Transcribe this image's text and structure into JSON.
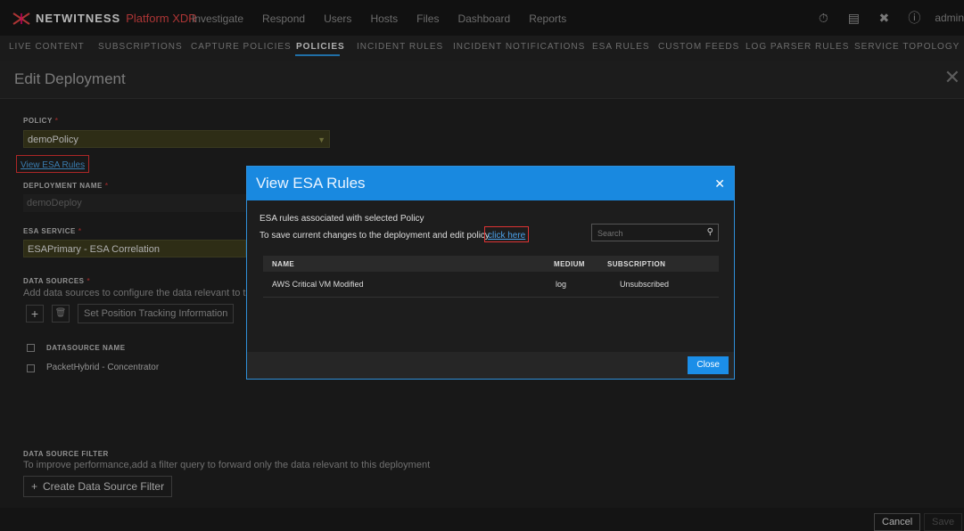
{
  "app": {
    "brand_name": "NETWITNESS",
    "brand_product": "Platform XDR",
    "nav": [
      "Investigate",
      "Respond",
      "Users",
      "Hosts",
      "Files",
      "Dashboard",
      "Reports"
    ],
    "user": "admin"
  },
  "subnav": {
    "tabs": [
      "LIVE CONTENT",
      "SUBSCRIPTIONS",
      "CAPTURE POLICIES",
      "POLICIES",
      "INCIDENT RULES",
      "INCIDENT NOTIFICATIONS",
      "ESA RULES",
      "CUSTOM FEEDS",
      "LOG PARSER RULES",
      "SERVICE TOPOLOGY"
    ],
    "active": "POLICIES"
  },
  "page": {
    "title": "Edit Deployment",
    "policy_label": "POLICY",
    "policy_value": "demoPolicy",
    "view_rules_link": "View ESA Rules",
    "deployment_name_label": "DEPLOYMENT NAME",
    "deployment_name_value": "demoDeploy",
    "esa_service_label": "ESA SERVICE",
    "esa_service_value": "ESAPrimary - ESA Correlation",
    "data_sources_label": "DATA SOURCES",
    "data_sources_desc": "Add data sources to configure the data relevant to this dep",
    "set_position_btn": "Set Position Tracking Information",
    "datasource_col": "DATASOURCE NAME",
    "datasource_rows": [
      "PacketHybrid - Concentrator"
    ],
    "filter_label": "DATA SOURCE FILTER",
    "filter_desc": "To improve performance,add a filter query to forward only the data relevant to this deployment",
    "create_filter_btn": "Create Data Source Filter",
    "cancel_btn": "Cancel",
    "save_btn": "Save"
  },
  "modal": {
    "title": "View ESA Rules",
    "line1": "ESA rules associated with selected Policy",
    "line2": "To save current changes to the deployment and edit policy",
    "link": "click here",
    "search_placeholder": "Search",
    "columns": [
      "NAME",
      "MEDIUM",
      "SUBSCRIPTION"
    ],
    "rows": [
      {
        "name": "AWS Critical VM Modified",
        "medium": "log",
        "subscription": "Unsubscribed"
      }
    ],
    "close_btn": "Close"
  },
  "colors": {
    "accent": "#1989e0",
    "highlight_box": "#dd3333",
    "field_bg": "#3b3a1d"
  }
}
